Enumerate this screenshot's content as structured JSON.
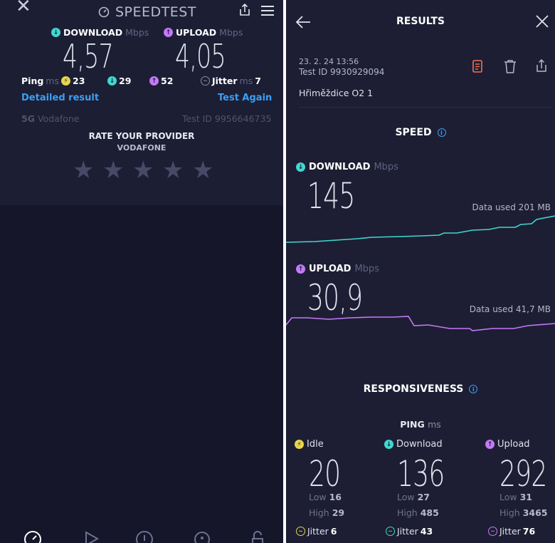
{
  "left": {
    "title": "SPEEDTEST",
    "download_label": "DOWNLOAD",
    "upload_label": "UPLOAD",
    "unit_mbps": "Mbps",
    "download_value": "4,57",
    "upload_value": "4,05",
    "ping_label": "Ping",
    "unit_ms": "ms",
    "ping_idle": "23",
    "ping_download": "29",
    "ping_upload": "52",
    "jitter_label": "Jitter",
    "jitter_value": "7",
    "detailed_result": "Detailed result",
    "test_again": "Test Again",
    "network_type": "5G",
    "provider_name": "Vodafone",
    "test_id": "Test ID 9956646735",
    "rate_heading": "RATE YOUR PROVIDER",
    "rate_provider": "VODAFONE",
    "stars_rating": 0,
    "stars_total": 5
  },
  "right": {
    "title": "RESULTS",
    "date": "23. 2. 24 13:56",
    "test_id": "Test ID 9930929094",
    "server": "Hřiměždice O2 1",
    "speed_heading": "SPEED",
    "download_label": "DOWNLOAD",
    "upload_label": "UPLOAD",
    "unit_mbps": "Mbps",
    "download_value": "145",
    "upload_value": "30,9",
    "download_data_used": "Data used 201 MB",
    "upload_data_used": "Data used 41,7 MB",
    "responsiveness_heading": "RESPONSIVENESS",
    "ping_label": "PING",
    "unit_ms": "ms",
    "low_label": "Low",
    "high_label": "High",
    "jitter_label": "Jitter",
    "idle": {
      "label": "Idle",
      "value": "20",
      "low": "16",
      "high": "29",
      "jitter": "6"
    },
    "download": {
      "label": "Download",
      "value": "136",
      "low": "27",
      "high": "485",
      "jitter": "43"
    },
    "upload": {
      "label": "Upload",
      "value": "292",
      "low": "31",
      "high": "3465",
      "jitter": "76"
    }
  },
  "colors": {
    "download": "#3fd8d0",
    "upload": "#c479f6",
    "idle": "#e6d64a",
    "link": "#3c9ff4",
    "report_icon": "#f0734f"
  },
  "icons": [
    "close-icon",
    "gauge-icon",
    "share-icon",
    "menu-icon",
    "back-icon",
    "report-icon",
    "trash-icon",
    "info-icon",
    "download-arrow-icon",
    "upload-arrow-icon",
    "idle-icon",
    "jitter-icon",
    "star-icon"
  ]
}
